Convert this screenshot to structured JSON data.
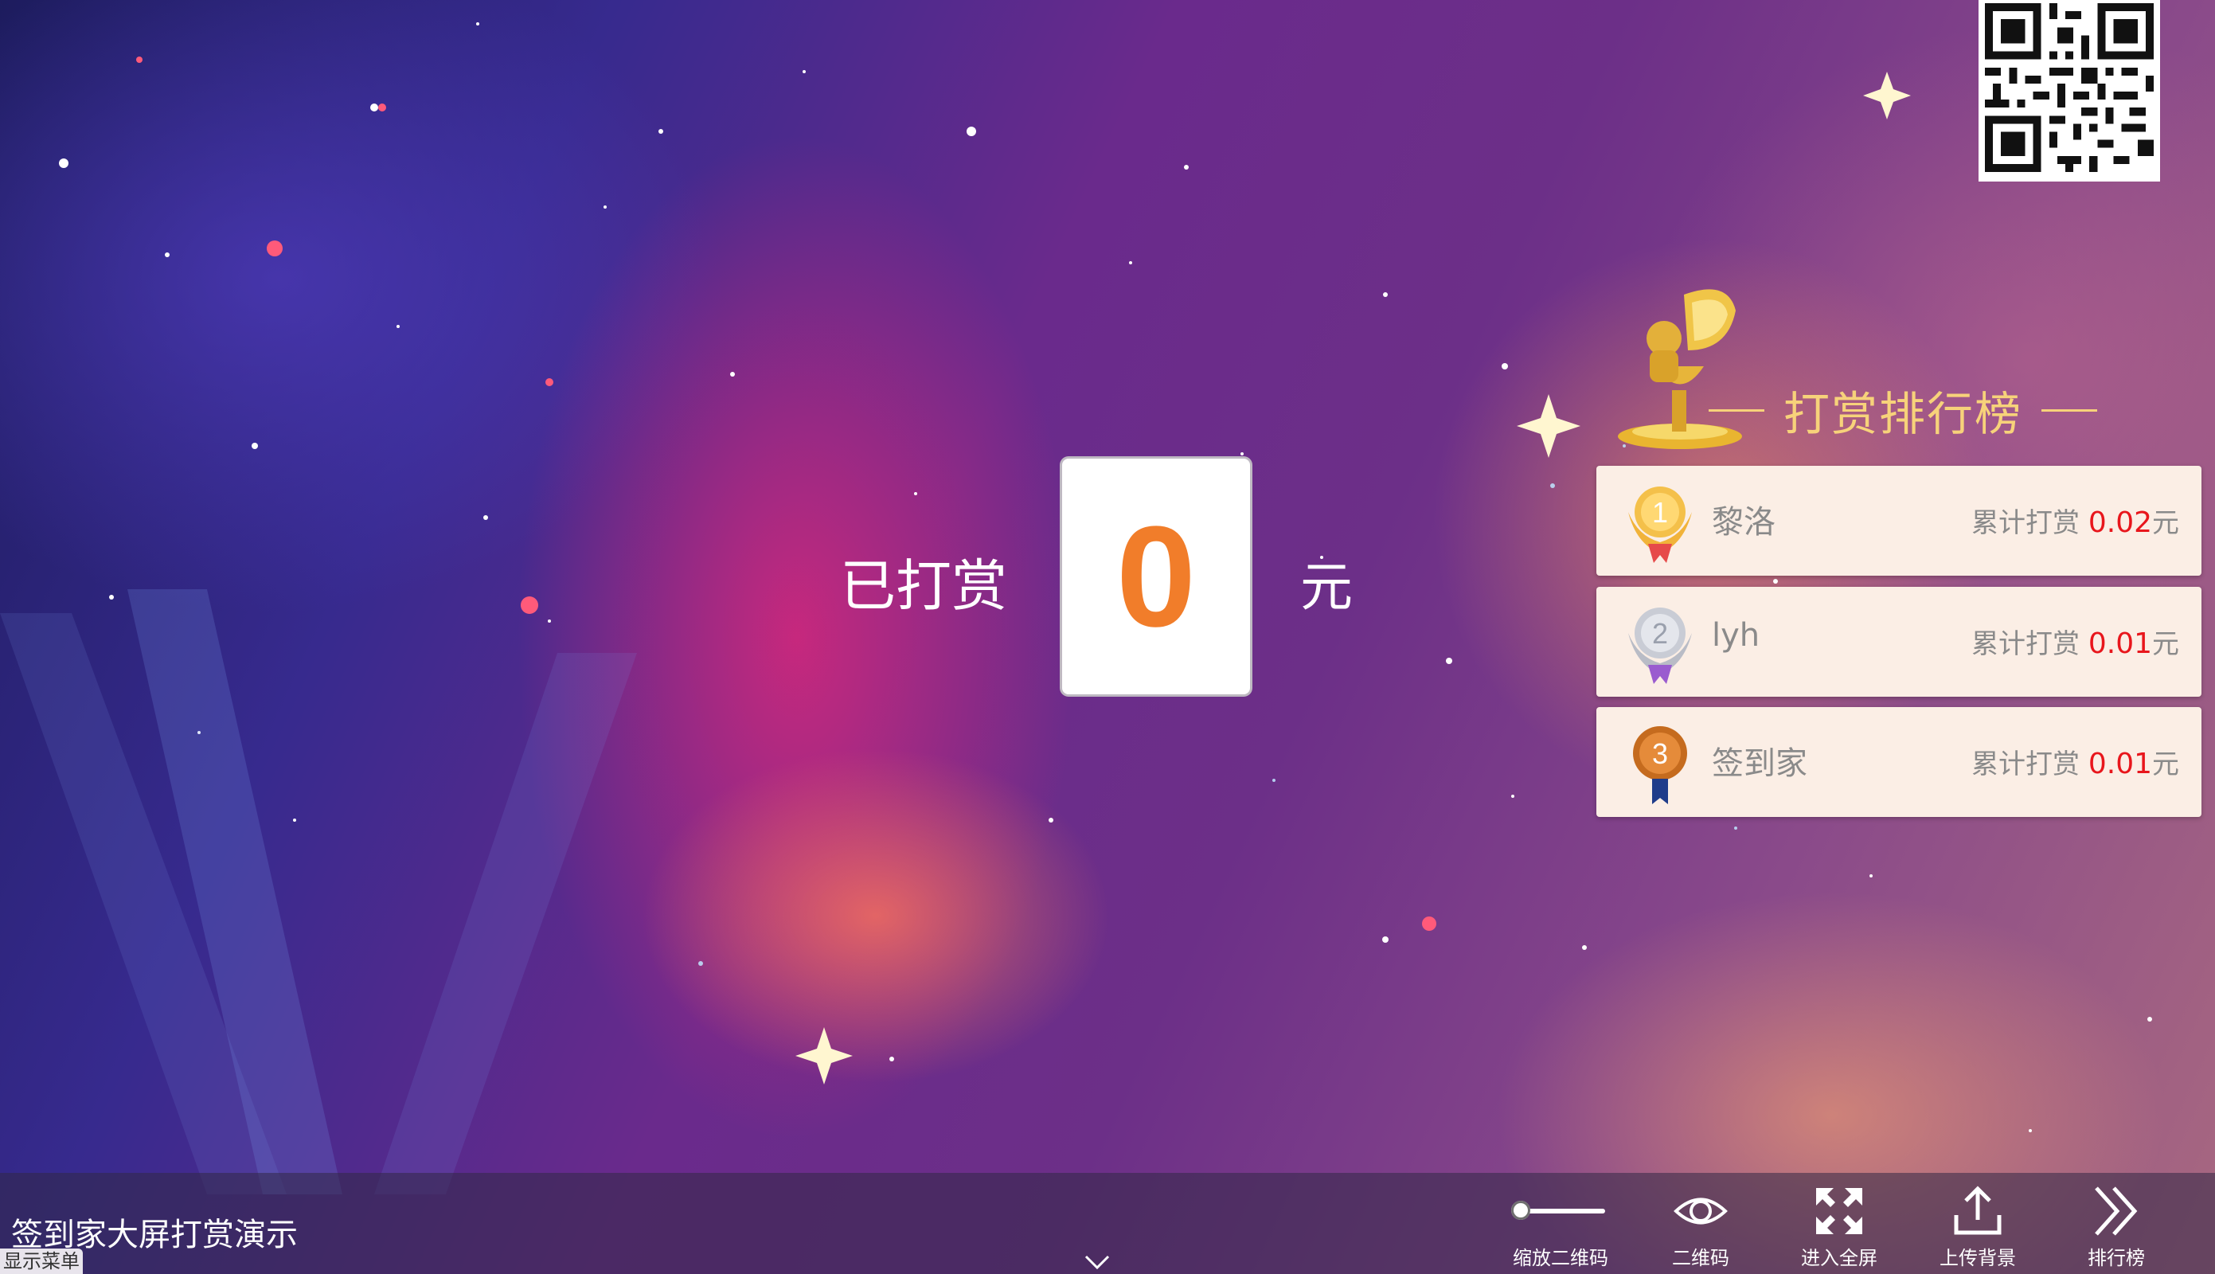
{
  "app": {
    "event_title": "签到家大屏打赏演示",
    "menu_tab_label": "显示菜单"
  },
  "summary": {
    "prefix_label": "已打赏",
    "value": "0",
    "unit": "元",
    "value_color": "#f17d2a"
  },
  "leaderboard": {
    "title": "打赏排行榜",
    "title_color": "#f7d27a",
    "amount_color": "#e8161c",
    "entries": [
      {
        "rank": "1",
        "name": "黎洛",
        "amount_label": "累计打赏",
        "amount": "0.02",
        "unit": "元",
        "medal": "gold-medal-icon"
      },
      {
        "rank": "2",
        "name": "lyh",
        "amount_label": "累计打赏",
        "amount": "0.01",
        "unit": "元",
        "medal": "silver-medal-icon"
      },
      {
        "rank": "3",
        "name": "签到家",
        "amount_label": "累计打赏",
        "amount": "0.01",
        "unit": "元",
        "medal": "bronze-medal-icon"
      }
    ]
  },
  "toolbar": {
    "zoom_qr_label": "缩放二维码",
    "qr_label": "二维码",
    "fullscreen_label": "进入全屏",
    "upload_bg_label": "上传背景",
    "ranking_label": "排行榜",
    "icons": {
      "qr": "eye-icon",
      "fullscreen": "expand-icon",
      "upload": "upload-icon",
      "ranking": "double-chevron-right-icon"
    }
  }
}
